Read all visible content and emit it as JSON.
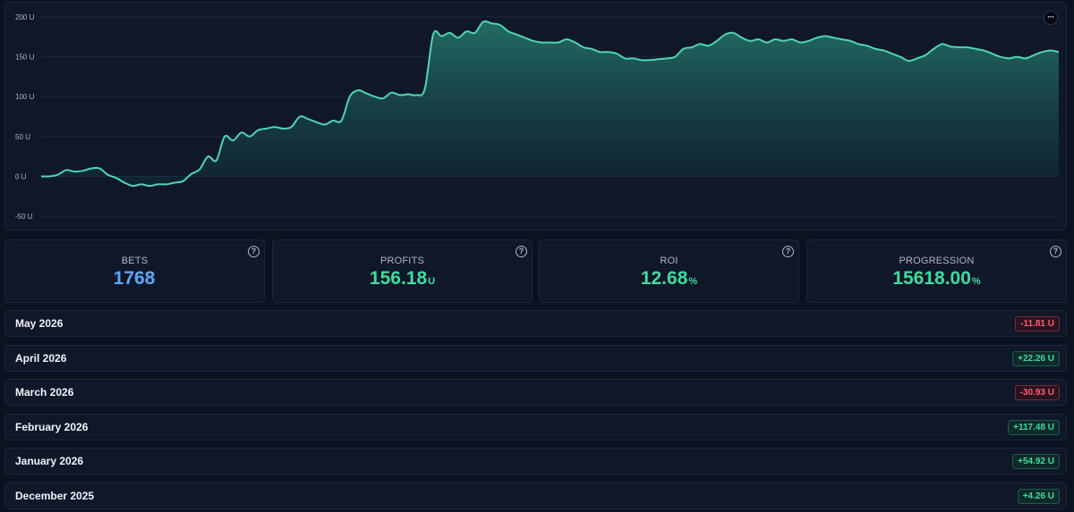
{
  "chart_data": {
    "type": "area",
    "yaxis": {
      "ticks": [
        "200 U",
        "150 U",
        "100 U",
        "50 U",
        "0 U",
        "-50 U"
      ],
      "values": [
        200,
        150,
        100,
        50,
        0,
        -50
      ],
      "ylim": [
        -55,
        205
      ]
    },
    "grid": true,
    "line_color": "#4fd6b0",
    "series": [
      {
        "values": [
          0,
          0,
          2,
          8,
          6,
          7,
          10,
          10,
          2,
          -2,
          -8,
          -12,
          -10,
          -12,
          -10,
          -10,
          -8,
          -6,
          3,
          9,
          25,
          20,
          50,
          45,
          55,
          50,
          58,
          60,
          62,
          60,
          62,
          75,
          72,
          68,
          65,
          70,
          70,
          100,
          108,
          104,
          100,
          98,
          105,
          102,
          103,
          102,
          110,
          178,
          176,
          180,
          174,
          182,
          180,
          194,
          192,
          190,
          182,
          178,
          174,
          170,
          168,
          168,
          168,
          172,
          168,
          162,
          160,
          156,
          156,
          154,
          148,
          148,
          146,
          146,
          147,
          148,
          150,
          160,
          162,
          166,
          164,
          170,
          178,
          180,
          174,
          170,
          172,
          168,
          172,
          170,
          172,
          168,
          170,
          174,
          176,
          174,
          172,
          170,
          166,
          164,
          160,
          158,
          154,
          150,
          145,
          148,
          152,
          160,
          166,
          163,
          162,
          162,
          160,
          158,
          154,
          150,
          148,
          150,
          148,
          152,
          156,
          158,
          156
        ],
        "stroke": "#4fd6b0"
      }
    ]
  },
  "chart_menu": {
    "icon": "more-icon",
    "label": "···"
  },
  "stats": [
    {
      "label": "BETS",
      "value": "1768",
      "unit": "",
      "color": "#5ea8f5"
    },
    {
      "label": "PROFITS",
      "value": "156.18",
      "unit": "U",
      "color": "#3fdc9c"
    },
    {
      "label": "ROI",
      "value": "12.68",
      "unit": "%",
      "color": "#3fdc9c"
    },
    {
      "label": "PROGRESSION",
      "value": "15618.00",
      "unit": "%",
      "color": "#3fdc9c"
    }
  ],
  "help_icon": {
    "icon": "help-icon",
    "glyph": "?"
  },
  "months": [
    {
      "name": "May 2026",
      "value": "-11.81 U",
      "status": "neg"
    },
    {
      "name": "April 2026",
      "value": "+22.26 U",
      "status": "pos"
    },
    {
      "name": "March 2026",
      "value": "-30.93 U",
      "status": "neg"
    },
    {
      "name": "February 2026",
      "value": "+117.48 U",
      "status": "pos"
    },
    {
      "name": "January 2026",
      "value": "+54.92 U",
      "status": "pos"
    },
    {
      "name": "December 2025",
      "value": "+4.26 U",
      "status": "pos"
    }
  ]
}
